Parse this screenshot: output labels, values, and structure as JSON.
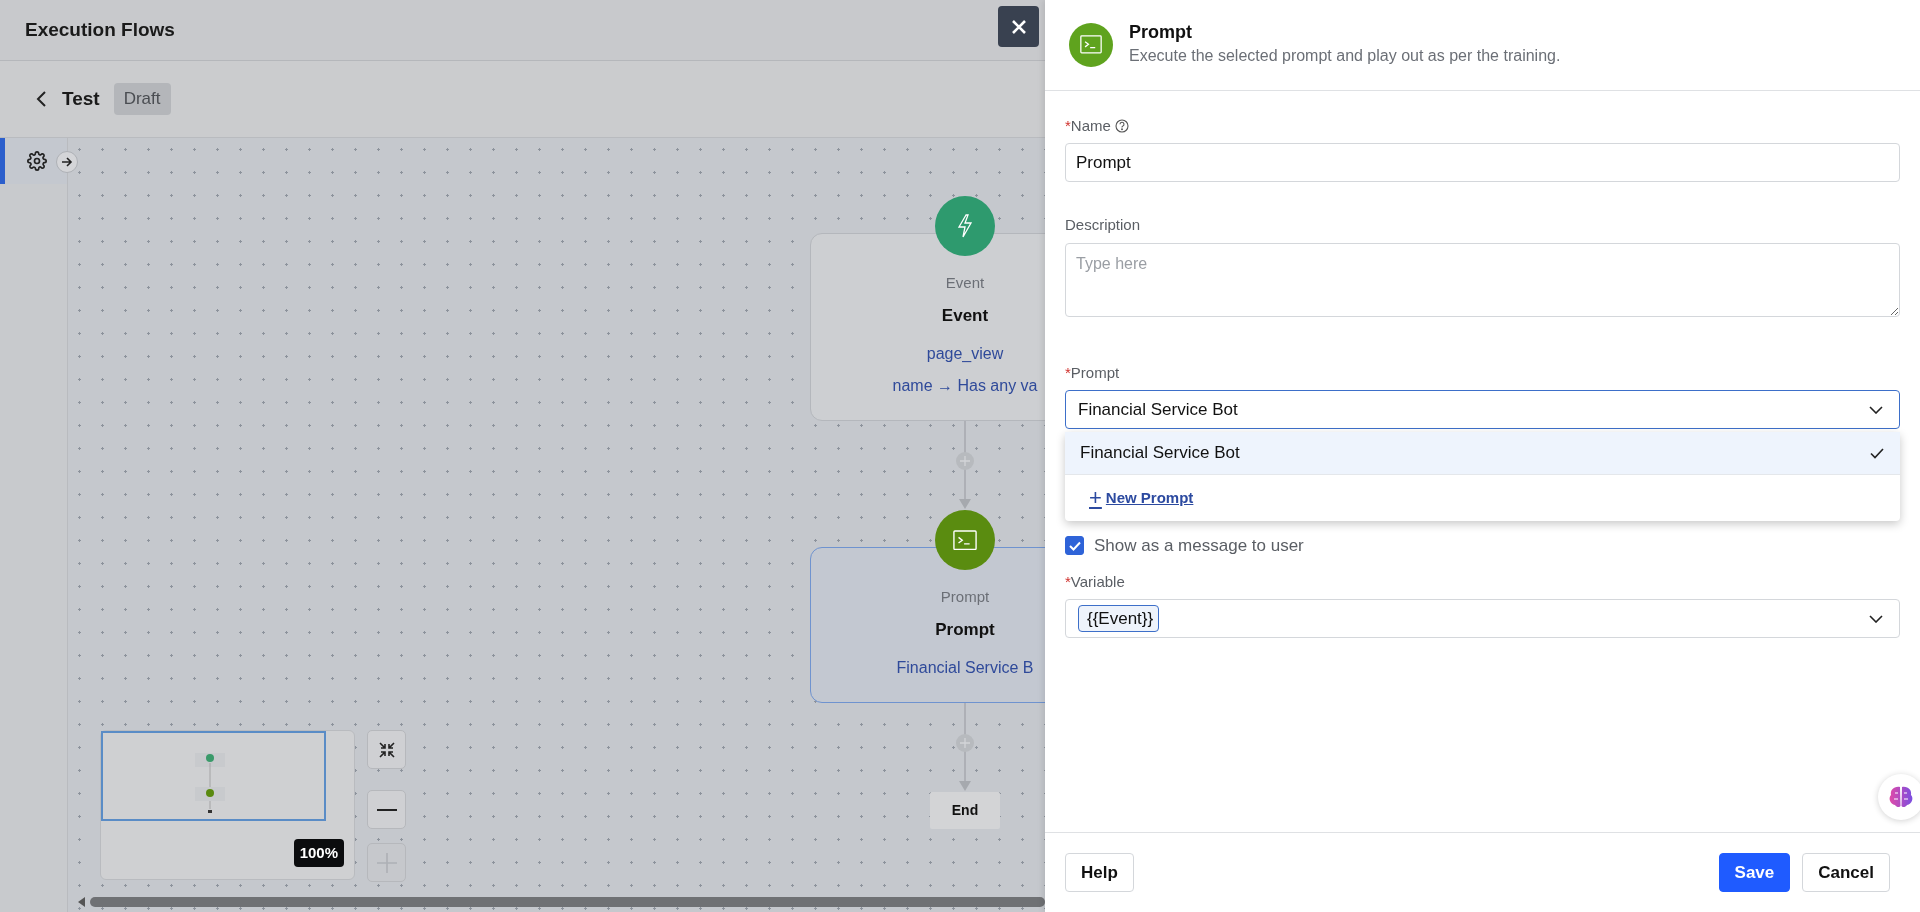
{
  "app": {
    "title": "Execution Flows"
  },
  "flow": {
    "name": "Test",
    "status": "Draft"
  },
  "canvas": {
    "nodes": [
      {
        "kind": "event",
        "type_label": "Event",
        "title": "Event",
        "lines": [
          "page_view"
        ],
        "condition": {
          "field": "name",
          "arrow": "→",
          "value": "Has any va"
        },
        "selected": false
      },
      {
        "kind": "prompt",
        "type_label": "Prompt",
        "title": "Prompt",
        "lines": [
          "Financial Service B"
        ],
        "selected": true
      }
    ],
    "end": "End",
    "zoom": "100%"
  },
  "panel": {
    "kind": "prompt",
    "title": "Prompt",
    "subtitle": "Execute the selected prompt and play out as per the training.",
    "fields": [
      {
        "kind": "text",
        "required_mark": "*",
        "label": "Name",
        "has_help": true,
        "value": "Prompt"
      },
      {
        "kind": "textarea",
        "label": "Description",
        "placeholder": "Type here"
      },
      {
        "kind": "select",
        "required_mark": "*",
        "label": "Prompt",
        "value": "Financial Service Bot",
        "expanded": true,
        "options": [
          {
            "label": "Financial Service Bot",
            "selected": true
          }
        ],
        "action": {
          "icon": "+",
          "label": "New Prompt"
        }
      },
      {
        "kind": "checkbox",
        "label": "Show as a message to user",
        "checked": true
      },
      {
        "kind": "tags",
        "required_mark": "*",
        "label": "Variable",
        "tags": [
          "{{Event}}"
        ]
      }
    ],
    "buttons": [
      {
        "kind": "secondary",
        "label": "Help"
      },
      {
        "kind": "primary",
        "label": "Save"
      },
      {
        "kind": "secondary",
        "label": "Cancel"
      }
    ]
  }
}
